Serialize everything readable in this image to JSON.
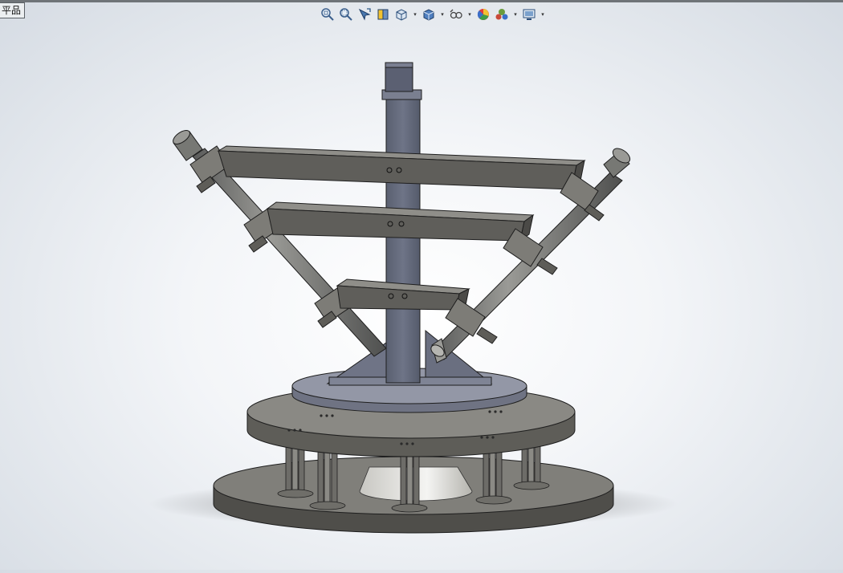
{
  "graphics_area": {
    "label_tab": "平品"
  },
  "heads_up_toolbar": {
    "items": [
      {
        "icon": "zoom-to-fit-icon",
        "dropdown": false
      },
      {
        "icon": "zoom-to-area-icon",
        "dropdown": false
      },
      {
        "icon": "previous-view-icon",
        "dropdown": false
      },
      {
        "icon": "section-view-icon",
        "dropdown": false
      },
      {
        "icon": "view-orientation-icon",
        "dropdown": true
      },
      {
        "icon": "display-style-icon",
        "dropdown": true
      },
      {
        "icon": "hide-show-items-icon",
        "dropdown": true
      },
      {
        "icon": "edit-appearance-icon",
        "dropdown": false
      },
      {
        "icon": "apply-scene-icon",
        "dropdown": true
      },
      {
        "icon": "view-settings-icon",
        "dropdown": true
      }
    ]
  },
  "model": {
    "name": "assembly-3d-model",
    "colors": {
      "steel": "#8f8e89",
      "steel_dark": "#5f5e5a",
      "column": "#6c7182",
      "plate": "#9397a6",
      "edge": "#1e1e1e"
    }
  }
}
